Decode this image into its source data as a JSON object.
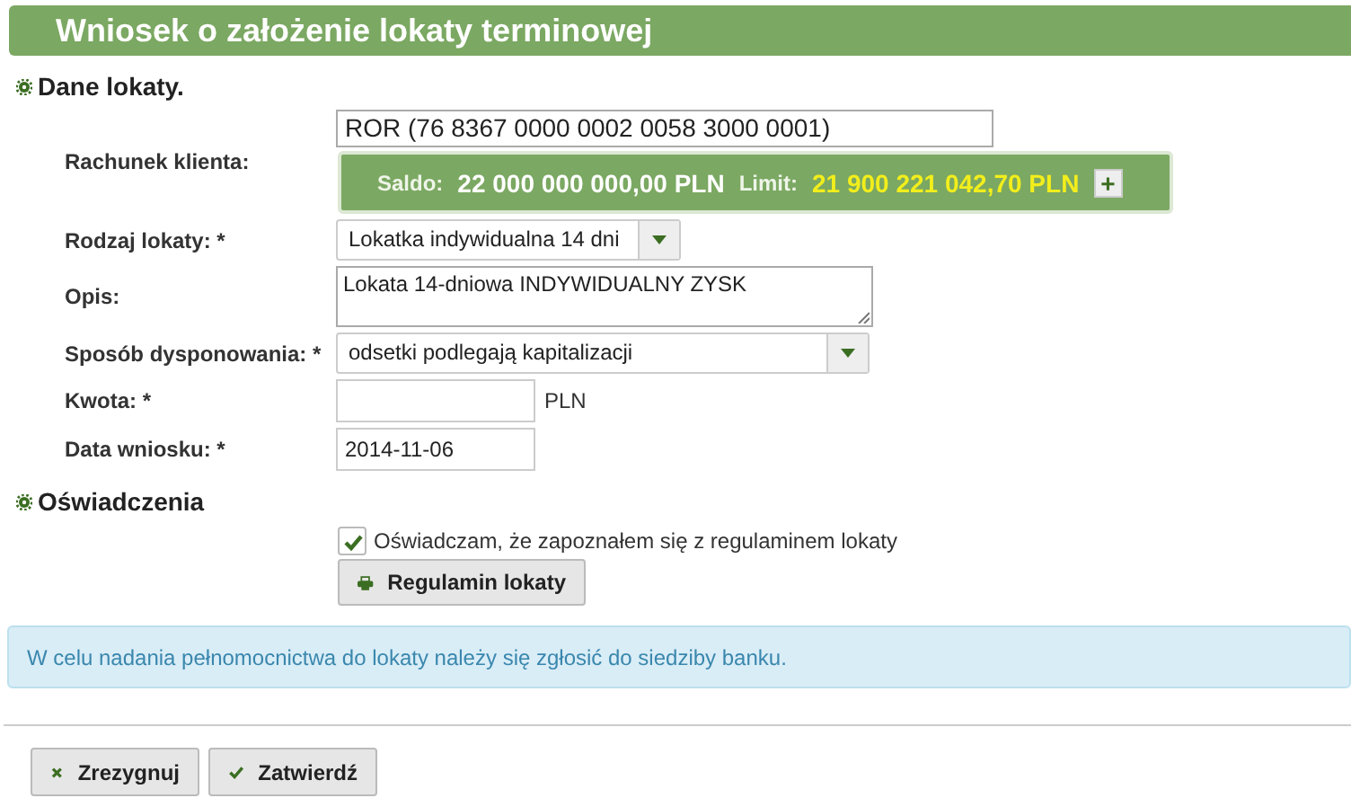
{
  "window": {
    "title": "Wniosek o założenie lokaty terminowej"
  },
  "section_deposit": {
    "title": "Dane lokaty.",
    "account": {
      "label": "Rachunek klienta:",
      "value": "ROR (76 8367 0000 0002 0058 3000 0001)",
      "balance_label": "Saldo:",
      "balance": "22 000 000 000,00 PLN",
      "limit_label": "Limit:",
      "limit": "21 900 221 042,70 PLN",
      "expand_button": "+"
    },
    "fields": [
      {
        "kind": "select",
        "label": "Rodzaj lokaty: *",
        "value": "Lokatka indywidualna 14 dni"
      },
      {
        "kind": "textarea",
        "label": "Opis:",
        "value": "Lokata 14-dniowa INDYWIDUALNY ZYSK"
      },
      {
        "kind": "select",
        "label": "Sposób dysponowania: *",
        "value": "odsetki podlegają kapitalizacji"
      },
      {
        "kind": "input",
        "label": "Kwota: *",
        "suffix": "PLN"
      },
      {
        "kind": "input",
        "label": "Data wniosku: *",
        "value": "2014-11-06"
      }
    ]
  },
  "section_statements": {
    "title": "Oświadczenia",
    "checkbox": {
      "label": "Oświadczam, że zapoznałem się z regulaminem lokaty",
      "checked": true
    },
    "button": "Regulamin lokaty"
  },
  "info": "W celu nadania pełnomocnictwa do lokaty należy się zgłosić do siedziby banku.",
  "buttons": [
    {
      "kind": "cancel",
      "label": "Zrezygnuj"
    },
    {
      "kind": "confirm",
      "label": "Zatwierdź"
    }
  ]
}
